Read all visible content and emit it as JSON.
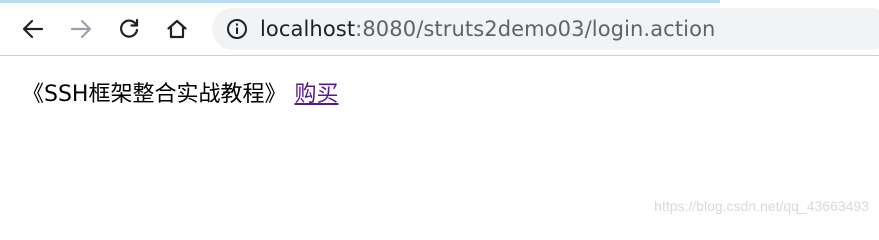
{
  "browser": {
    "url_host": "localhost",
    "url_rest": ":8080/struts2demo03/login.action",
    "icons": {
      "back": "back-arrow-icon",
      "forward": "forward-arrow-icon",
      "reload": "reload-icon",
      "home": "home-icon",
      "info": "info-icon"
    }
  },
  "page": {
    "book_title": "《SSH框架整合实战教程》",
    "buy_link": "购买"
  },
  "watermark": "https://blog.csdn.net/qq_43663493"
}
